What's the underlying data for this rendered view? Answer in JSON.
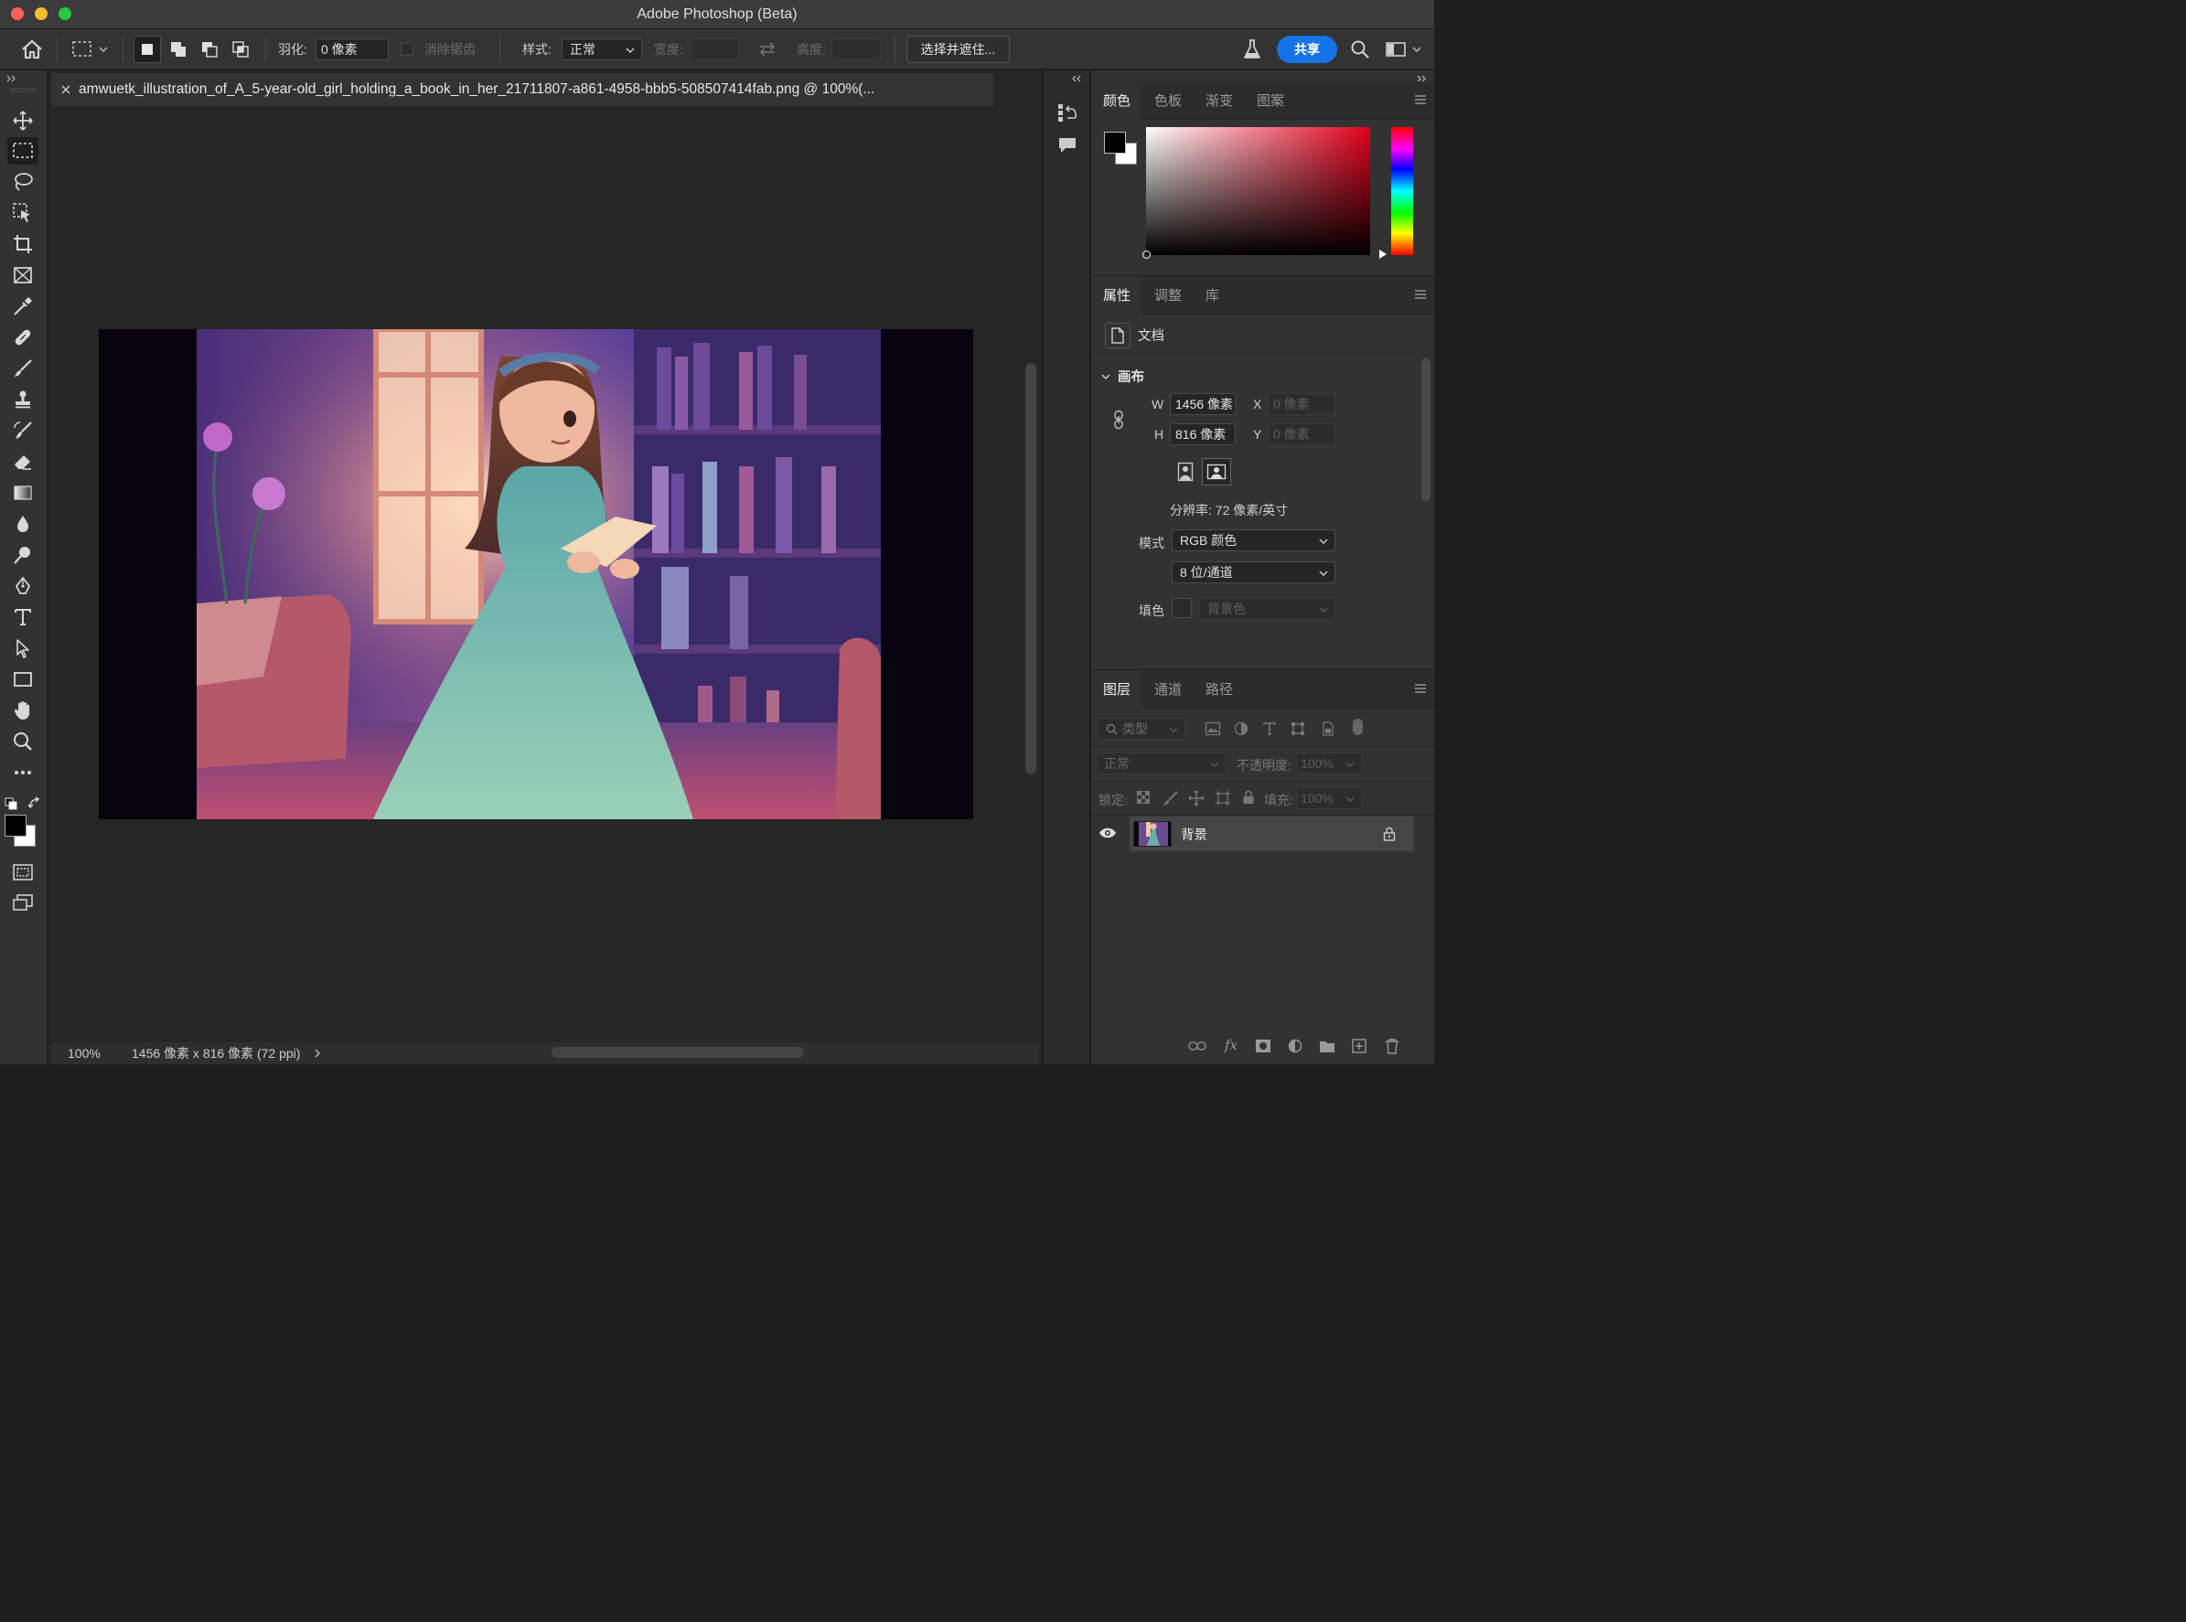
{
  "window": {
    "title": "Adobe Photoshop (Beta)"
  },
  "options_bar": {
    "feather_label": "羽化:",
    "feather_value": "0 像素",
    "antialias_label": "消除锯齿",
    "style_label": "样式:",
    "style_value": "正常",
    "width_label": "宽度:",
    "height_label": "高度:",
    "select_mask_button": "选择并遮住...",
    "share_button": "共享"
  },
  "document": {
    "tab_title": "amwuetk_illustration_of_A_5-year-old_girl_holding_a_book_in_her_21711807-a861-4958-bbb5-508507414fab.png @ 100%(...",
    "zoom": "100%",
    "info": "1456 像素 x 816 像素 (72 ppi)"
  },
  "color_panel": {
    "tabs": [
      "颜色",
      "色板",
      "渐变",
      "图案"
    ],
    "foreground": "#000000",
    "background": "#ffffff",
    "hue_color": "#e3001b"
  },
  "properties_panel": {
    "tabs": [
      "属性",
      "调整",
      "库"
    ],
    "doc_label": "文档",
    "canvas_section": "画布",
    "w_label": "W",
    "w_value": "1456 像素",
    "h_label": "H",
    "h_value": "816 像素",
    "x_label": "X",
    "x_value": "0 像素",
    "y_label": "Y",
    "y_value": "0 像素",
    "resolution": "分辨率: 72 像素/英寸",
    "mode_label": "模式",
    "mode_value": "RGB 颜色",
    "bit_depth": "8 位/通道",
    "fill_label": "填色",
    "fill_value": "背景色"
  },
  "layers_panel": {
    "tabs": [
      "图层",
      "通道",
      "路径"
    ],
    "filter_placeholder": "类型",
    "blend_mode": "正常",
    "opacity_label": "不透明度:",
    "opacity_value": "100%",
    "lock_label": "锁定:",
    "fill_label": "填充:",
    "fill_value": "100%",
    "layers": [
      {
        "name": "背景",
        "visible": true,
        "locked": true
      }
    ]
  }
}
